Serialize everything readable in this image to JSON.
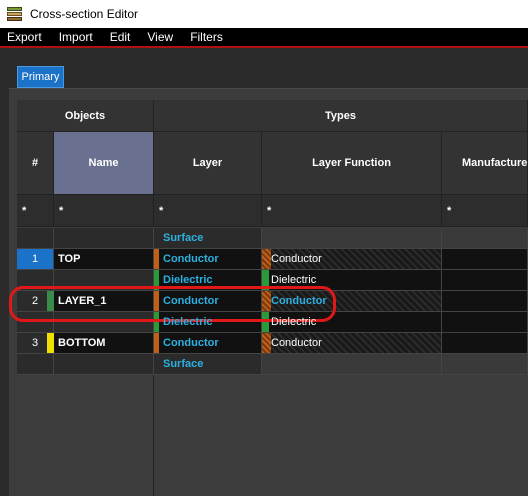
{
  "window": {
    "title": "Cross-section Editor"
  },
  "menu": [
    "Export",
    "Import",
    "Edit",
    "View",
    "Filters"
  ],
  "tabs": [
    {
      "label": "Primary"
    }
  ],
  "headers": {
    "group_objects": "Objects",
    "group_types": "Types",
    "col_num": "#",
    "col_name": "Name",
    "col_layer": "Layer",
    "col_function": "Layer Function",
    "col_manufacturer": "Manufacture"
  },
  "filters": {
    "num": "*",
    "name": "*",
    "layer": "*",
    "function": "*",
    "manufacturer": "*"
  },
  "rows": [
    {
      "num": "",
      "name": "",
      "layer": "Surface",
      "function": ""
    },
    {
      "num": "1",
      "name": "TOP",
      "layer": "Conductor",
      "function": "Conductor"
    },
    {
      "num": "",
      "name": "",
      "layer": "Dielectric",
      "function": "Dielectric"
    },
    {
      "num": "2",
      "name": "LAYER_1",
      "layer": "Conductor",
      "function": "Conductor"
    },
    {
      "num": "",
      "name": "",
      "layer": "Dielectric",
      "function": "Dielectric"
    },
    {
      "num": "3",
      "name": "BOTTOM",
      "layer": "Conductor",
      "function": "Conductor"
    },
    {
      "num": "",
      "name": "",
      "layer": "Surface",
      "function": ""
    }
  ],
  "colors": {
    "selection_blue": "#1a73c8",
    "conductor_orange": "#c06018",
    "dielectric_green": "#2a9a3a",
    "top_marker": "#2a7fd0",
    "layer1_marker": "#3a8a4a",
    "bottom_marker": "#f0e000",
    "annotation_red": "#e01818"
  }
}
